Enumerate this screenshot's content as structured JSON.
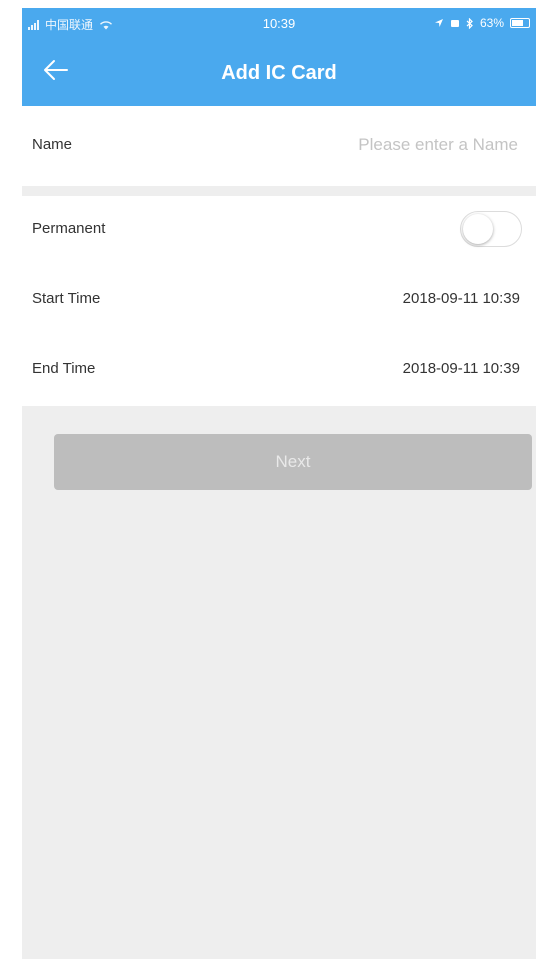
{
  "status_bar": {
    "carrier": "中国联通",
    "time": "10:39",
    "battery": "63%"
  },
  "nav": {
    "back_icon": "arrow-left-icon",
    "title": "Add IC Card"
  },
  "form": {
    "name": {
      "label": "Name",
      "placeholder": "Please enter a Name",
      "value": ""
    },
    "permanent": {
      "label": "Permanent",
      "enabled": false
    },
    "start_time": {
      "label": "Start Time",
      "value": "2018-09-11 10:39"
    },
    "end_time": {
      "label": "End Time",
      "value": "2018-09-11 10:39"
    }
  },
  "next_button": {
    "label": "Next",
    "enabled": false
  },
  "colors": {
    "header": "#4aa9ee",
    "background": "#eeeeee",
    "button_disabled": "#bdbdbd"
  }
}
